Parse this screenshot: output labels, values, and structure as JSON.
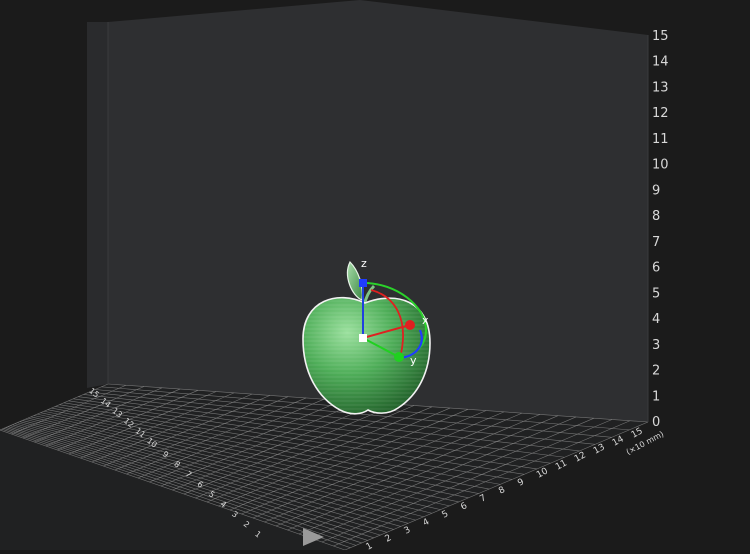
{
  "viewport": {
    "z_axis_ticks": [
      "0",
      "1",
      "2",
      "3",
      "4",
      "5",
      "6",
      "7",
      "8",
      "9",
      "10",
      "11",
      "12",
      "13",
      "14",
      "15"
    ],
    "front_axis_ticks": [
      "1",
      "2",
      "3",
      "4",
      "5",
      "6",
      "7",
      "8",
      "9",
      "10",
      "11",
      "12",
      "13",
      "14",
      "15"
    ],
    "left_axis_ticks": [
      "1",
      "2",
      "3",
      "4",
      "5",
      "6",
      "7",
      "8",
      "9",
      "10",
      "11",
      "12",
      "13",
      "14",
      "15"
    ],
    "unit_label": "(×10 mm)",
    "gizmo_labels": {
      "x": "x",
      "y": "y",
      "z": "z"
    },
    "colors": {
      "background": "#1b1b1b",
      "wall": "#2d2e30",
      "floor": "#1f2021",
      "grid": "#8a8a8a",
      "tick_text": "#d8d8d8",
      "model": "#5fb868",
      "gizmo_x": "#e02020",
      "gizmo_y": "#20d020",
      "gizmo_z": "#2040e0",
      "gizmo_ring_blue": "#1f3cff"
    },
    "model_name": "apple",
    "tool_icon": "play-triangle-icon"
  }
}
